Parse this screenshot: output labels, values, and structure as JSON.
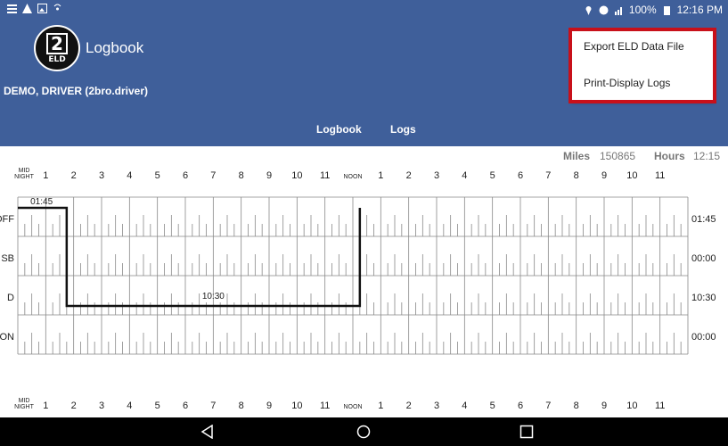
{
  "status_bar": {
    "time": "12:16 PM",
    "battery": "100%"
  },
  "app_bar": {
    "logo_big": "2",
    "logo_small": "ELD",
    "title": "Logbook",
    "driver": "DEMO, DRIVER (2bro.driver)"
  },
  "tabs": [
    {
      "label": "Logbook",
      "active": true
    },
    {
      "label": "Logs",
      "active": false
    }
  ],
  "menu": {
    "items": [
      "Export ELD Data File",
      "Print-Display Logs"
    ],
    "highlight_color": "#c8101a"
  },
  "stats": {
    "miles_label": "Miles",
    "miles_value": "150865",
    "hours_label": "Hours",
    "hours_value": "12:15"
  },
  "grid": {
    "hour_labels": [
      "1",
      "2",
      "3",
      "4",
      "5",
      "6",
      "7",
      "8",
      "9",
      "10",
      "11",
      "NOON",
      "1",
      "2",
      "3",
      "4",
      "5",
      "6",
      "7",
      "8",
      "9",
      "10",
      "11"
    ],
    "midnight_top": "MID",
    "midnight_bottom": "NIGHT",
    "rows": [
      {
        "label": "OFF",
        "total": "01:45"
      },
      {
        "label": "SB",
        "total": "00:00"
      },
      {
        "label": "D",
        "total": "10:30"
      },
      {
        "label": "ON",
        "total": "00:00"
      }
    ],
    "segments": [
      {
        "row": "OFF",
        "start": 0,
        "end": 1.75
      },
      {
        "row": "D",
        "start": 1.75,
        "end": 12.25
      },
      {
        "row": "OFF",
        "start": 12.25,
        "end": 12.25
      }
    ],
    "duration_labels": [
      {
        "text": "01:45",
        "row": "OFF",
        "at_hour": 0.85
      },
      {
        "text": "10:30",
        "row": "D",
        "at_hour": 7.0
      }
    ]
  },
  "colors": {
    "app_bar": "#3f5f9a",
    "grid_line": "#888888",
    "log_line": "#111111"
  },
  "nav_icons": [
    "back-icon",
    "home-icon",
    "recents-icon"
  ]
}
